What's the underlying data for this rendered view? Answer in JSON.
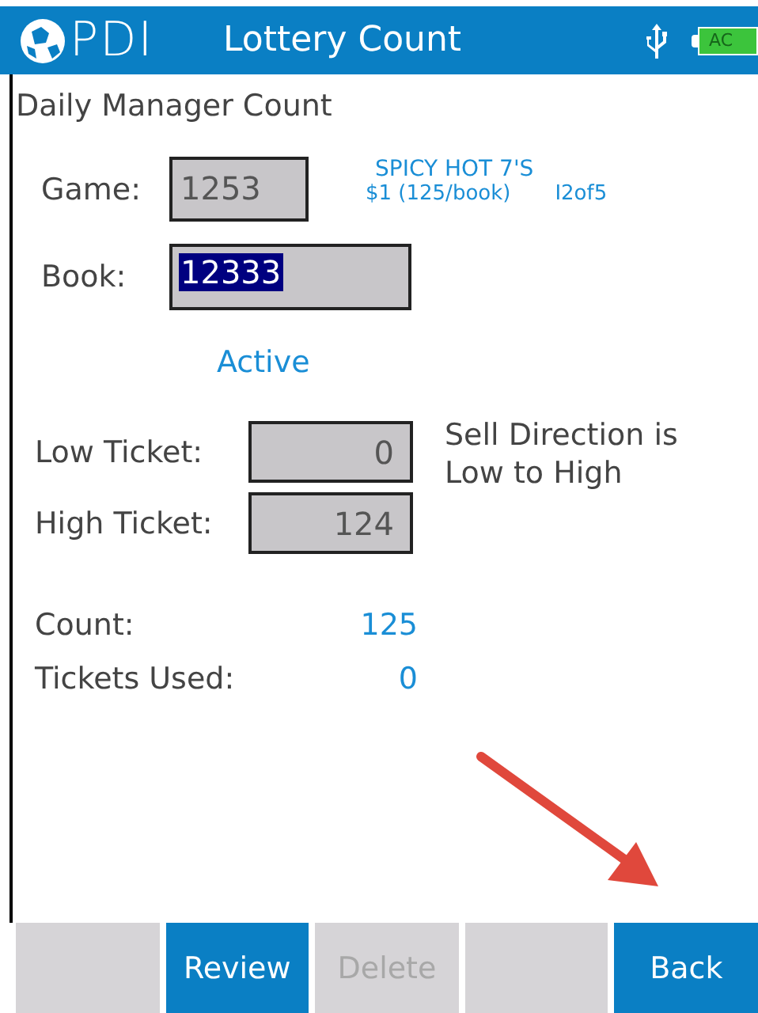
{
  "header": {
    "logo": "PDI",
    "title": "Lottery Count",
    "battery": "AC"
  },
  "subtitle": "Daily Manager Count",
  "game": {
    "label": "Game:",
    "value": "1253",
    "name": "SPICY HOT 7'S",
    "price": "$1 (125/book)",
    "code": "I2of5"
  },
  "book": {
    "label": "Book:",
    "value": "12333",
    "text_selected": true
  },
  "status": "Active",
  "low_ticket": {
    "label": "Low Ticket:",
    "value": "0"
  },
  "high_ticket": {
    "label": "High Ticket:",
    "value": "124"
  },
  "sell_direction": "Sell Direction is Low to High",
  "count": {
    "label": "Count:",
    "value": "125"
  },
  "tickets_used": {
    "label": "Tickets Used:",
    "value": "0"
  },
  "buttons": [
    {
      "disabled": true
    },
    {
      "label": "Review",
      "disabled": false
    },
    {
      "label": "Delete",
      "disabled": true
    },
    {
      "disabled": true
    },
    {
      "label": "Back",
      "disabled": false
    }
  ]
}
